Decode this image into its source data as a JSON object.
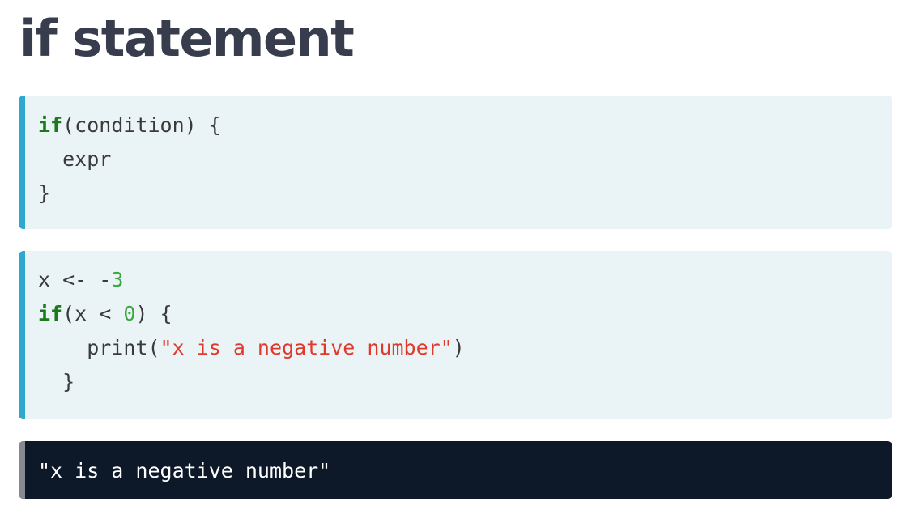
{
  "page": {
    "title": "if statement"
  },
  "colors": {
    "title": "#383d4e",
    "code_background": "#eaf3f6",
    "code_accent_bar": "#2fa8d0",
    "output_background": "#0d1828",
    "output_accent_bar": "#868a8f",
    "keyword": "#1b7a1b",
    "number": "#39a83a",
    "string": "#e0392b"
  },
  "syntax_block": {
    "line1_keyword": "if",
    "line1_rest": "(condition) {",
    "line2": "  expr",
    "line3": "}"
  },
  "example_block": {
    "line1_code": "x <- -",
    "line1_number": "3",
    "line2_keyword": "if",
    "line2_pre": "(x < ",
    "line2_number": "0",
    "line2_post": ") {",
    "line3_pre": "    print(",
    "line3_string": "\"x is a negative number\"",
    "line3_post": ")",
    "line4": "  }"
  },
  "output_block": {
    "text": "\"x is a negative number\""
  }
}
